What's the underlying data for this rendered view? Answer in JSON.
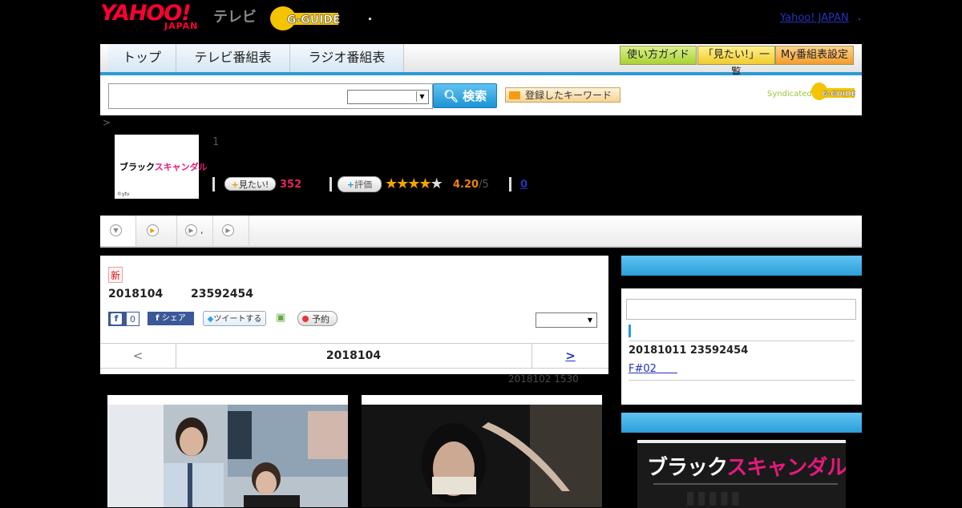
{
  "header": {
    "logo_yahoo": "YAHOO!",
    "logo_japan": "JAPAN",
    "logo_tv": "テレビ",
    "logo_gguide": "G-GUIDE",
    "yahoo_japan_link": "Yahoo! JAPAN"
  },
  "nav": {
    "tabs": [
      "トップ",
      "テレビ番組表",
      "ラジオ番組表"
    ],
    "right_buttons": [
      "使い方ガイド",
      "「見たい!」一覧",
      "My番組表設定"
    ]
  },
  "search": {
    "button_label": "検索",
    "keyword_button": "登録したキーワード",
    "syndicated_label": "Syndicated",
    "syndicated_logo": "G-GUIDE"
  },
  "breadcrumb": ">",
  "program": {
    "thumb_title_black": "ブラック",
    "thumb_title_pink": "スキャンダル",
    "thumb_copyright": "©ytv",
    "episode_number": "1",
    "mitai_label": "見たい!",
    "mitai_count": "352",
    "hyoka_label": "評価",
    "rating_value": "4.20",
    "rating_max": "/5",
    "rating_stars": 4.2,
    "comments_count": "0"
  },
  "tabs": {
    "items": [
      {
        "icon": "chevron-down-circle-icon",
        "label": ""
      },
      {
        "icon": "play-circle-icon",
        "label": ","
      },
      {
        "icon": "play-circle-icon",
        "label": ""
      },
      {
        "icon": "play-circle-icon",
        "label": ""
      }
    ]
  },
  "main": {
    "new_badge": "新",
    "date": "2018104",
    "time": "23592454",
    "fb_like_count": "0",
    "fb_share_label": "シェア",
    "tweet_label": "ツイートする",
    "yoyaku_label": "予約",
    "pager_prev": "<",
    "pager_current": "2018104",
    "pager_next": ">",
    "previous_onair": "2018102  1530"
  },
  "sidebar": {
    "entry_date": "20181011  23592454",
    "entry_link": "F#02　　"
  },
  "poster": {
    "title_white": "ブラック",
    "title_pink": "スキャンダル"
  },
  "colors": {
    "accent_blue": "#2a9ad6",
    "mitai_red": "#e0245e",
    "rating_orange": "#f08300",
    "link_blue": "#2233bb"
  }
}
